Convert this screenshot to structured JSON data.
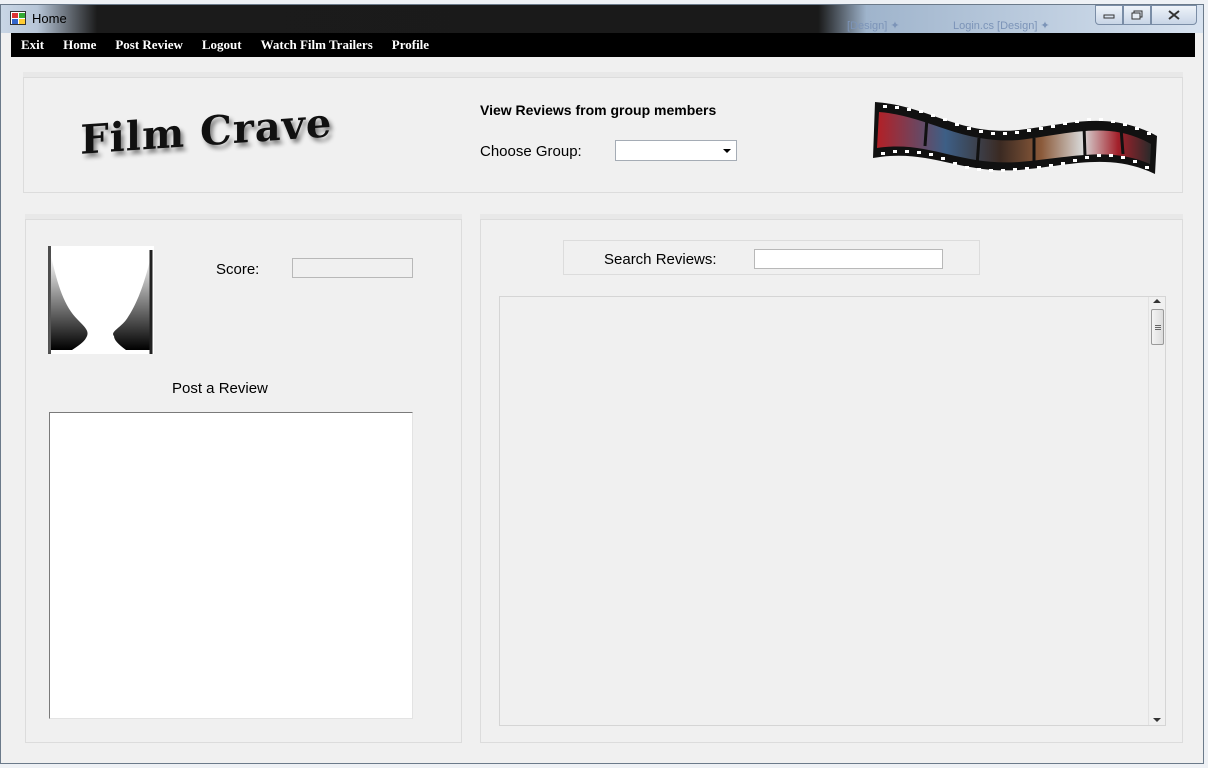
{
  "window": {
    "title": "Home",
    "controls": {
      "minimize_icon": "minimize-icon",
      "maximize_icon": "maximize-icon",
      "close_icon": "close-icon"
    }
  },
  "background": {
    "ghost_tab_1": "[Design] ✦",
    "ghost_tab_2": "Login.cs [Design] ✦"
  },
  "menu": {
    "items": [
      "Exit",
      "Home",
      "Post Review",
      "Logout",
      "Watch Film Trailers",
      "Profile"
    ]
  },
  "header": {
    "logo_text": "Film Crave",
    "view_reviews_title": "View Reviews from group members",
    "choose_group_label": "Choose Group:",
    "group_selected": ""
  },
  "profile": {
    "score_label": "Score:",
    "score_value": "",
    "post_review_title": "Post a Review",
    "review_text": ""
  },
  "reviews": {
    "search_label": "Search Reviews:",
    "search_value": ""
  },
  "colors": {
    "menubar": "#000000",
    "window_bg": "#f0f0f0",
    "filmstrip_accent": "#c8202a"
  }
}
